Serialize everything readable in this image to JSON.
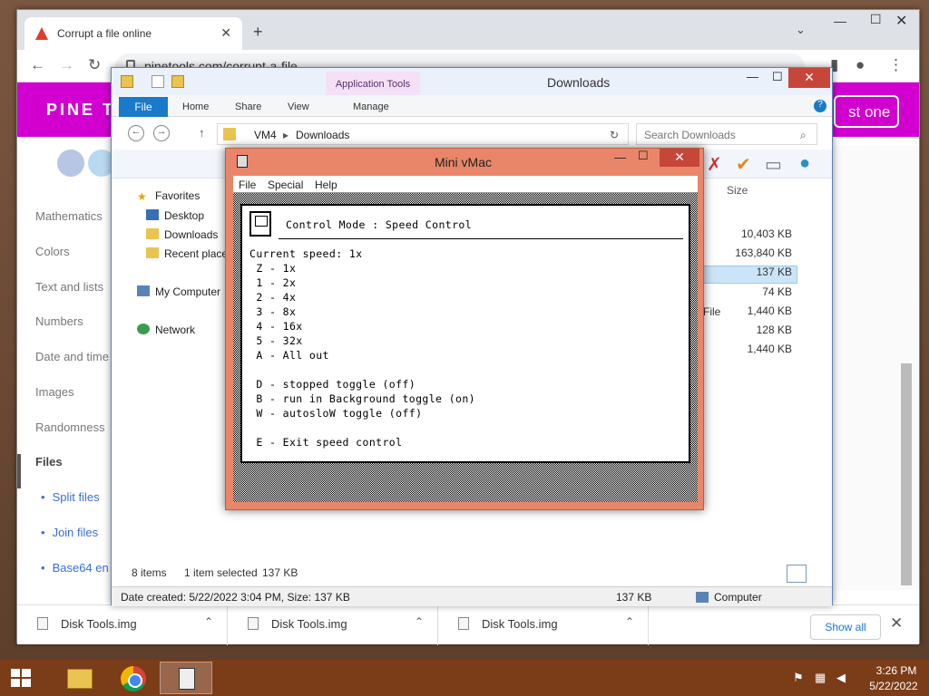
{
  "chrome": {
    "tab_title": "Corrupt a file online",
    "url": "pinetools.com/corrupt-a-file",
    "new_tab": "+",
    "tab_close": "✕"
  },
  "page": {
    "logo": "PINE T",
    "header_button": "st one",
    "nav": [
      "Mathematics",
      "Colors",
      "Text and lists",
      "Numbers",
      "Date and time",
      "Images",
      "Randomness",
      "Files"
    ],
    "nav_sub": [
      "Split files",
      "Join files",
      "Base64 en"
    ],
    "downloads": [
      {
        "name": "Disk Tools.img"
      },
      {
        "name": "Disk Tools.img"
      },
      {
        "name": "Disk Tools.img"
      }
    ],
    "show_all": "Show all"
  },
  "explorer": {
    "title": "Downloads",
    "app_tools": "Application Tools",
    "ribbon": {
      "file": "File",
      "home": "Home",
      "share": "Share",
      "view": "View",
      "manage": "Manage"
    },
    "breadcrumb": [
      "VM4",
      "Downloads"
    ],
    "search_placeholder": "Search Downloads",
    "col_size": "Size",
    "tree": {
      "favorites": "Favorites",
      "desktop": "Desktop",
      "downloads": "Downloads",
      "recent": "Recent place",
      "computer": "My Computer",
      "network": "Network"
    },
    "sizes": [
      "10,403 KB",
      "163,840 KB",
      "137 KB",
      "74 KB",
      "1,440 KB",
      "128 KB",
      "1,440 KB"
    ],
    "type_fragment": "File",
    "status": {
      "items": "8 items",
      "selected": "1 item selected",
      "selected_size": "137 KB"
    },
    "details": {
      "created": "Date created: 5/22/2022 3:04 PM, Size: 137 KB",
      "size": "137 KB",
      "location": "Computer"
    }
  },
  "vmac": {
    "title": "Mini vMac",
    "menus": [
      "File",
      "Special",
      "Help"
    ],
    "header": "Control Mode : Speed Control",
    "lines": [
      "Current speed: 1x",
      " Z - 1x",
      " 1 - 2x",
      " 2 - 4x",
      " 3 - 8x",
      " 4 - 16x",
      " 5 - 32x",
      " A - All out",
      "",
      " D - stopped toggle (off)",
      " B - run in Background toggle (on)",
      " W - autosloW toggle (off)",
      "",
      " E - Exit speed control"
    ]
  },
  "taskbar": {
    "time": "3:26 PM",
    "date": "5/22/2022"
  },
  "colors": {
    "pine_magenta": "#d100d1",
    "vmac_frame": "#e9866a",
    "taskbar": "#7b3c18",
    "close_red": "#c7463a",
    "link_blue": "#3a6fd1"
  }
}
